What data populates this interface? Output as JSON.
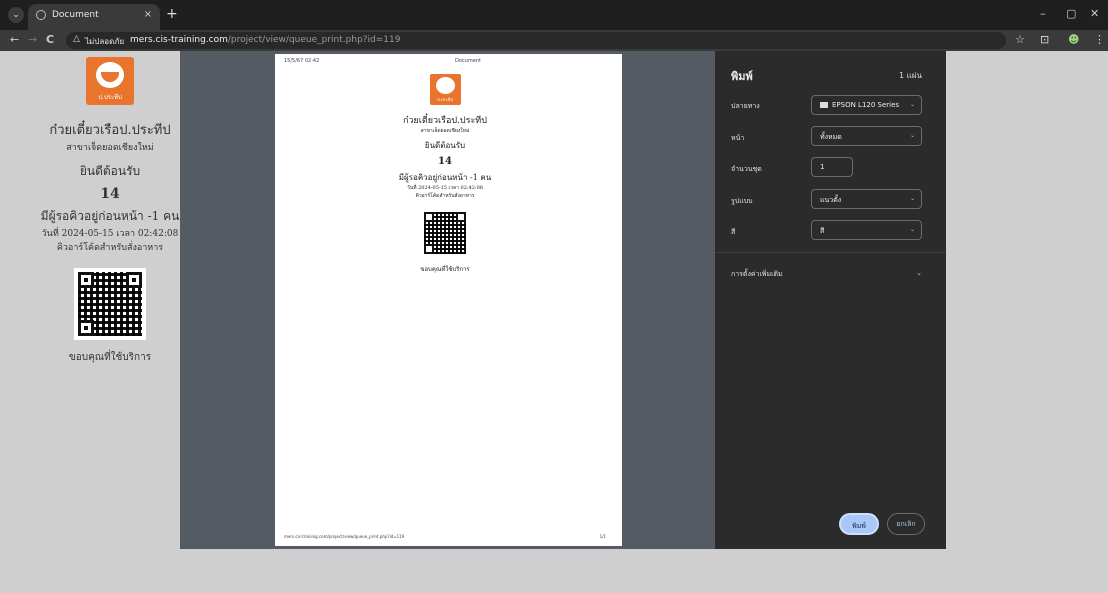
{
  "browser": {
    "tab_title": "Document",
    "tab_close": "×",
    "new_tab": "+",
    "window_controls": {
      "minimize": "–",
      "restore": "▢",
      "close": "✕"
    },
    "nav": {
      "back": "←",
      "forward": "→",
      "reload": "C"
    },
    "url": {
      "warning_icon": "△",
      "warning_text": "ไม่ปลอดภัย",
      "host": "mers.cis-training.com",
      "path": "/project/view/queue_print.php?id=119"
    },
    "icons": {
      "star": "☆",
      "extension": "⊡",
      "profile": "☻",
      "menu": "⋮"
    }
  },
  "receipt": {
    "logo_caption": "ป.ประทีป",
    "shop_name": "ก๋วยเตี๋ยวเรือป.ประทีป",
    "branch": "สาขาเจ็ดยอดเชียงใหม่",
    "welcome": "ยินดีต้อนรับ",
    "queue_number": "14",
    "people_ahead": "มีผู้รอคิวอยู่ก่อนหน้า -1 คน",
    "date_line": "วันที่ 2024-05-15 เวลา 02:42:08",
    "qr_note": "คิวอาร์โค้ดสำหรับสั่งอาหาร",
    "thanks": "ขอบคุณที่ใช้บริการ"
  },
  "preview": {
    "header_left": "15/5/67 02:42",
    "header_center": "Document",
    "footer_left": "mers.cis-training.com/project/view/queue_print.php?id=119",
    "footer_right": "1/1"
  },
  "print_panel": {
    "title": "พิมพ์",
    "sheet_count": "1 แผ่น",
    "destination_label": "ปลายทาง",
    "destination_value": "EPSON L120 Series",
    "pages_label": "หน้า",
    "pages_value": "ทั้งหมด",
    "copies_label": "จำนวนชุด",
    "copies_value": "1",
    "layout_label": "รูปแบบ",
    "layout_value": "แนวตั้ง",
    "color_label": "สี",
    "color_value": "สี",
    "more_settings": "การตั้งค่าเพิ่มเติม",
    "print_button": "พิมพ์",
    "cancel_button": "ยกเลิก",
    "caret": "⌄"
  },
  "colors": {
    "brand_orange": "#e8742d",
    "panel_bg": "#2b2b2b",
    "print_button": "#a8c7fa"
  }
}
